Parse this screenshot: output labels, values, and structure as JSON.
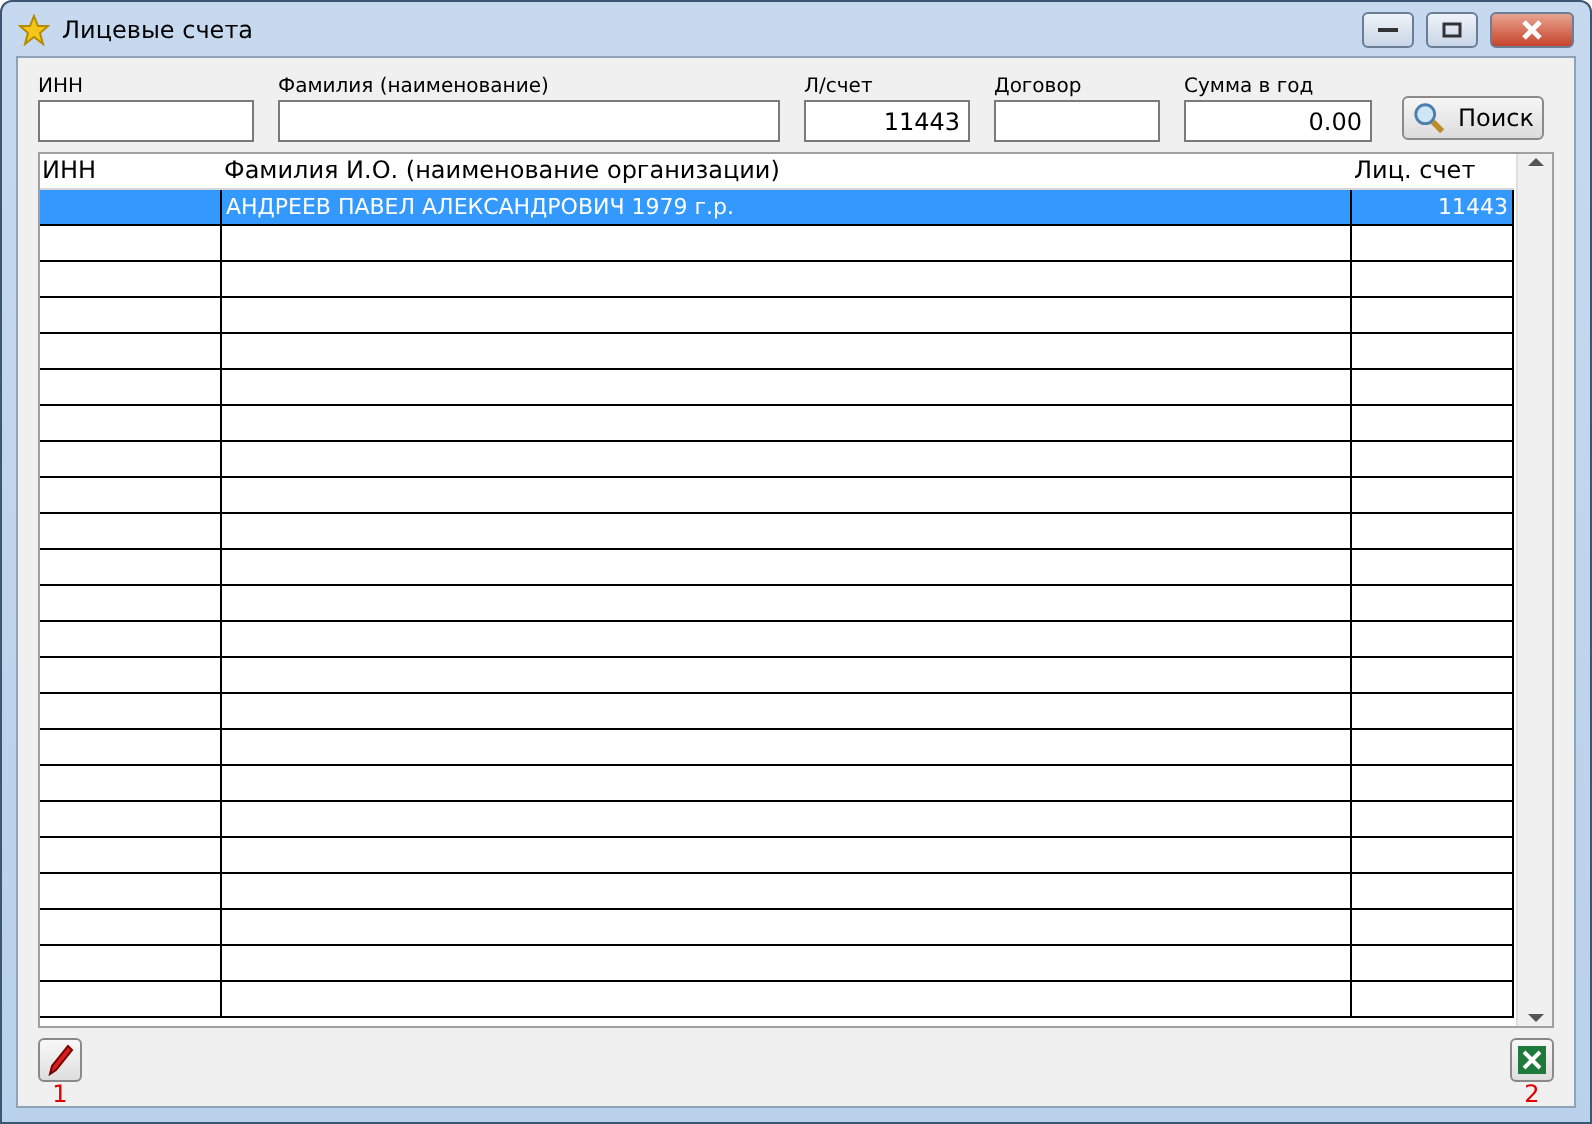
{
  "window": {
    "title": "Лицевые счета"
  },
  "filters": [
    {
      "label": "ИНН"
    },
    {
      "label": "Фамилия (наименование)"
    },
    {
      "label": "Л/счет",
      "value": "11443"
    },
    {
      "label": "Договор"
    },
    {
      "label": "Сумма в год",
      "value": "0.00"
    }
  ],
  "search_button": "Поиск",
  "table": {
    "columns": [
      "ИНН",
      "Фамилия И.О. (наименование организации)",
      "Лиц. счет"
    ],
    "rows": [
      {
        "cells": [
          "",
          "АНДРЕЕВ ПАВЕЛ АЛЕКСАНДРОВИЧ 1979 г.р.",
          "11443"
        ],
        "selected": true
      }
    ]
  },
  "footer_marks": [
    "1",
    "2"
  ]
}
